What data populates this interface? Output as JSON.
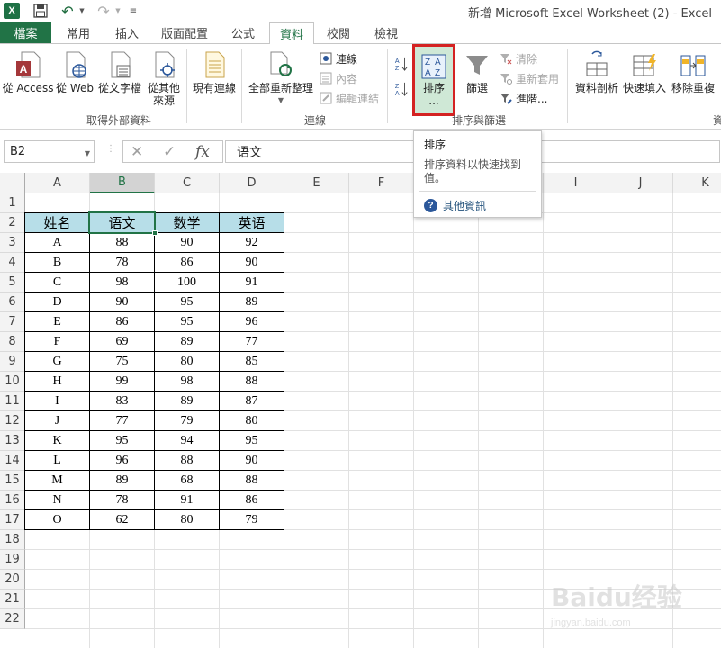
{
  "titlebar": {
    "window_title": "新增 Microsoft Excel Worksheet (2) - Excel",
    "app_logo_text": "X"
  },
  "tabs": [
    {
      "label": "檔案"
    },
    {
      "label": "常用"
    },
    {
      "label": "插入"
    },
    {
      "label": "版面配置"
    },
    {
      "label": "公式"
    },
    {
      "label": "資料"
    },
    {
      "label": "校閱"
    },
    {
      "label": "檢視"
    }
  ],
  "ribbon": {
    "get_external": {
      "group_label": "取得外部資料",
      "from_access": "從 Access",
      "from_web": "從 Web",
      "from_text": "從文字檔",
      "from_other_1": "從其他",
      "from_other_2": "來源",
      "existing": "現有連線"
    },
    "connections": {
      "group_label": "連線",
      "refresh_all": "全部重新整理",
      "connections": "連線",
      "properties": "內容",
      "edit_links": "編輯連結"
    },
    "sort_filter": {
      "group_label": "排序與篩選",
      "sort": "排序",
      "sort_ellipsis": "...",
      "filter": "篩選",
      "clear": "清除",
      "reapply": "重新套用",
      "advanced": "進階..."
    },
    "tools": {
      "text_to_columns": "資料剖析",
      "flash_fill": "快速填入",
      "remove_dup": "移除重複",
      "cut_label": "資"
    }
  },
  "formula_bar": {
    "name_box": "B2",
    "formula": "语文",
    "fx": "fx"
  },
  "columns": [
    "A",
    "B",
    "C",
    "D",
    "E",
    "F",
    "G",
    "H",
    "I",
    "J",
    "K"
  ],
  "rows": [
    "1",
    "2",
    "3",
    "4",
    "5",
    "6",
    "7",
    "8",
    "9",
    "10",
    "11",
    "12",
    "13",
    "14",
    "15",
    "16",
    "17",
    "18",
    "19",
    "20",
    "21",
    "22"
  ],
  "table": {
    "headers": [
      "姓名",
      "语文",
      "数学",
      "英语"
    ],
    "rows": [
      [
        "A",
        "88",
        "90",
        "92"
      ],
      [
        "B",
        "78",
        "86",
        "90"
      ],
      [
        "C",
        "98",
        "100",
        "91"
      ],
      [
        "D",
        "90",
        "95",
        "89"
      ],
      [
        "E",
        "86",
        "95",
        "96"
      ],
      [
        "F",
        "69",
        "89",
        "77"
      ],
      [
        "G",
        "75",
        "80",
        "85"
      ],
      [
        "H",
        "99",
        "98",
        "88"
      ],
      [
        "I",
        "83",
        "89",
        "87"
      ],
      [
        "J",
        "77",
        "79",
        "80"
      ],
      [
        "K",
        "95",
        "94",
        "95"
      ],
      [
        "L",
        "96",
        "88",
        "90"
      ],
      [
        "M",
        "89",
        "68",
        "88"
      ],
      [
        "N",
        "78",
        "91",
        "86"
      ],
      [
        "O",
        "62",
        "80",
        "79"
      ]
    ]
  },
  "tooltip": {
    "title": "排序",
    "description": "排序資料以快速找到值。",
    "help": "其他資訊"
  },
  "watermark": {
    "logo": "Baidu经验",
    "sub": "jingyan.baidu.com"
  },
  "colors": {
    "excel_green": "#217346",
    "header_fill": "#b7dee8",
    "highlight_red": "#d42222"
  }
}
